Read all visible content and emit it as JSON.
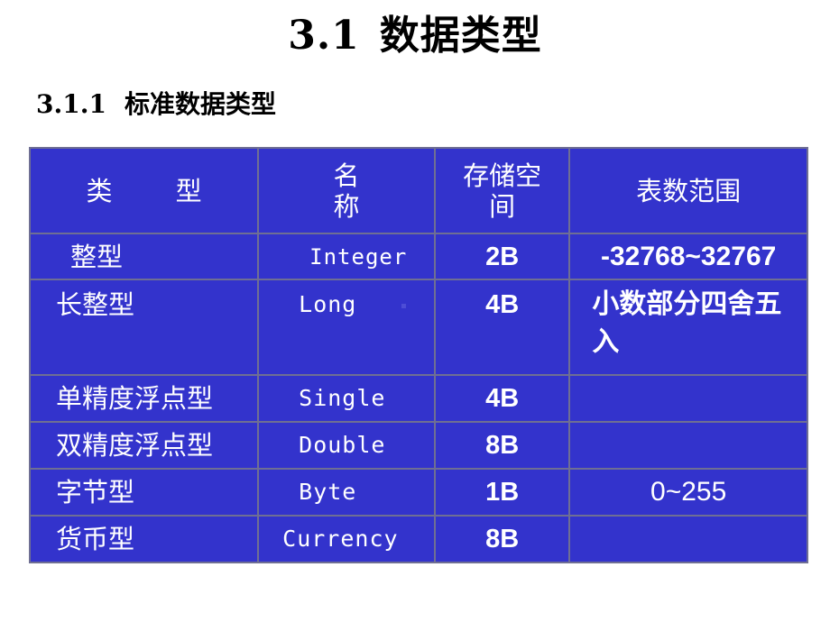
{
  "title": {
    "number": "3.1",
    "text": "数据类型"
  },
  "subtitle": {
    "number": "3.1.1",
    "text": "标准数据类型"
  },
  "table": {
    "headers": {
      "type_a": "类",
      "type_b": "型",
      "name_line1": "名",
      "name_line2": "称",
      "storage_line1": "存储空",
      "storage_line2": "间",
      "range": "表数范围"
    },
    "rows": [
      {
        "type": "整型",
        "name": "Integer",
        "size": "2B",
        "range": "-32768~32767"
      },
      {
        "type": "长整型",
        "name": "Long",
        "size": "4B",
        "range": "小数部分四舍五入"
      },
      {
        "type": "单精度浮点型",
        "name": "Single",
        "size": "4B",
        "range": ""
      },
      {
        "type": "双精度浮点型",
        "name": "Double",
        "size": "8B",
        "range": ""
      },
      {
        "type": "字节型",
        "name": "Byte",
        "size": "1B",
        "range": "0~255"
      },
      {
        "type": "货币型",
        "name": "Currency",
        "size": "8B",
        "range": ""
      }
    ],
    "colors": {
      "background": "#3333cc",
      "border": "#6f6f93",
      "text": "#ffffff"
    }
  }
}
